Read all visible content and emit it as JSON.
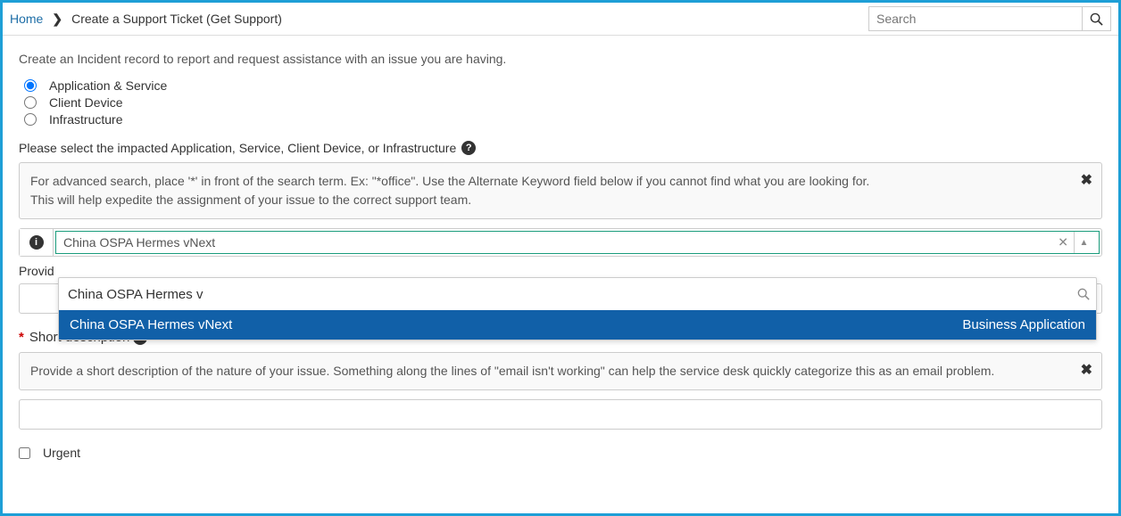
{
  "breadcrumb": {
    "home": "Home",
    "current": "Create a Support Ticket (Get Support)"
  },
  "search": {
    "placeholder": "Search"
  },
  "intro": "Create an Incident record to report and request assistance with an issue you are having.",
  "categories": {
    "app_service": "Application & Service",
    "client_device": "Client Device",
    "infrastructure": "Infrastructure"
  },
  "impacted_label": "Please select the impacted Application, Service, Client Device, or Infrastructure",
  "hint": {
    "line1": "For advanced search, place '*' in front of the search term. Ex: \"*office\". Use the Alternate Keyword field below if you cannot find what you are looking for.",
    "line2": "This will help expedite the assignment of your issue to the correct support team."
  },
  "lookup": {
    "selected": "China OSPA Hermes vNext",
    "search_value": "China OSPA Hermes v",
    "option_name": "China OSPA Hermes vNext",
    "option_type": "Business Application"
  },
  "alt_keyword_label_partial": "Provid",
  "short_desc": {
    "label": "Short description",
    "hint": "Provide a short description of the nature of your issue. Something along the lines of \"email isn't working\" can help the service desk quickly categorize this as an email problem."
  },
  "urgent_label": "Urgent"
}
